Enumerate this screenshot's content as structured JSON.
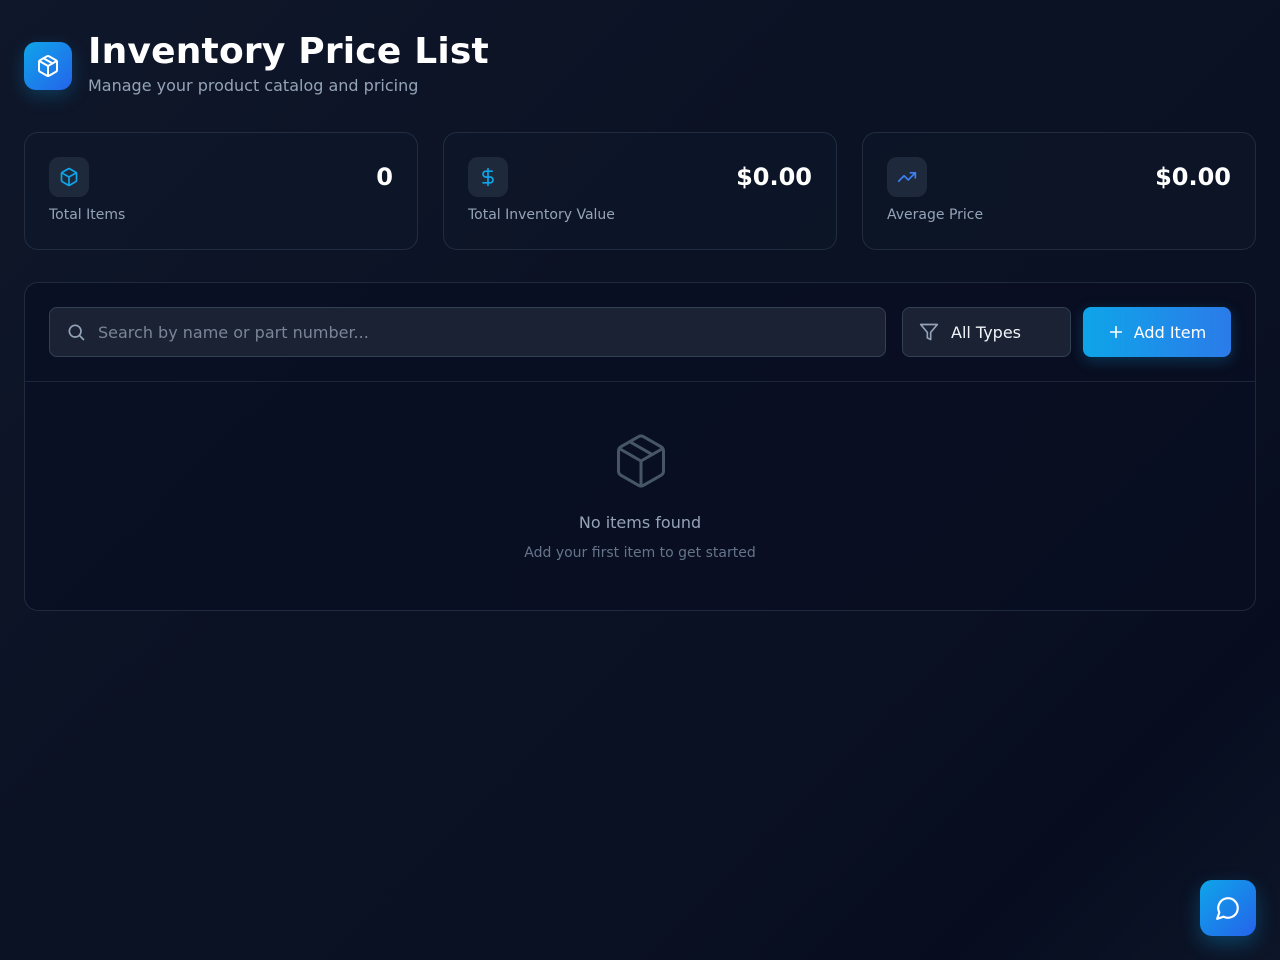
{
  "header": {
    "title": "Inventory Price List",
    "subtitle": "Manage your product catalog and pricing",
    "logo_icon": "package-icon"
  },
  "stats": [
    {
      "label": "Total Items",
      "value": "0",
      "icon": "package-icon",
      "icon_color": "#0ea5e9"
    },
    {
      "label": "Total Inventory Value",
      "value": "$0.00",
      "icon": "dollar-icon",
      "icon_color": "#0ea5e9"
    },
    {
      "label": "Average Price",
      "value": "$0.00",
      "icon": "trending-up-icon",
      "icon_color": "#3b82f6"
    }
  ],
  "toolbar": {
    "search_placeholder": "Search by name or part number...",
    "search_value": "",
    "type_filter_selected": "All Types",
    "add_label": "Add Item"
  },
  "empty_state": {
    "title": "No items found",
    "subtitle": "Add your first item to get started",
    "icon": "package-icon"
  },
  "chat": {
    "icon": "chat-bubble-icon"
  },
  "colors": {
    "accent": "#0ea5e9",
    "accent_secondary": "#2563eb",
    "background": "#0f172a",
    "card_border": "#334155",
    "muted_text": "#94a3b8"
  }
}
